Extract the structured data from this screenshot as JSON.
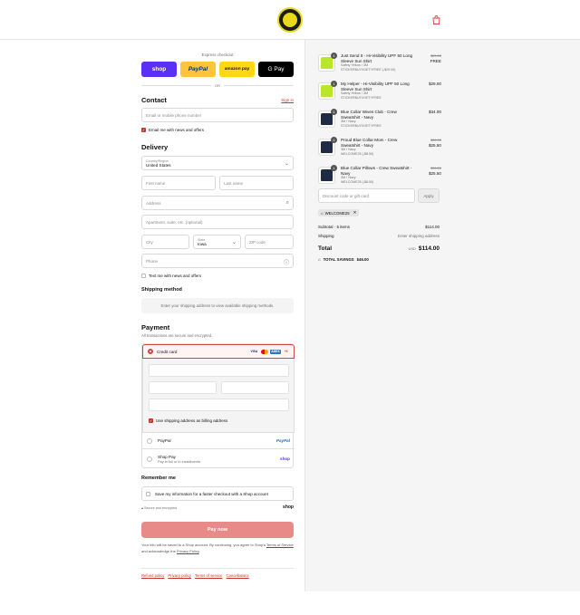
{
  "header": {
    "logo_icon": "store-logo-icon",
    "cart_icon": "shopping-bag-icon"
  },
  "express": {
    "label": "Express checkout",
    "buttons": [
      "shop",
      "PayPal",
      "amazon pay",
      "G Pay"
    ],
    "or": "OR"
  },
  "contact": {
    "title": "Contact",
    "sign_in": "Sign in",
    "email_placeholder": "Email or mobile phone number",
    "news_label": "Email me with news and offers"
  },
  "delivery": {
    "title": "Delivery",
    "country_label": "Country/Region",
    "country_value": "United States",
    "first_name": "First name",
    "last_name": "Last name",
    "address": "Address",
    "apartment": "Apartment, suite, etc. (optional)",
    "city": "City",
    "state_label": "State",
    "state_value": "Iowa",
    "zip": "ZIP code",
    "phone": "Phone",
    "text_label": "Text me with news and offers"
  },
  "shipping": {
    "title": "Shipping method",
    "note": "Enter your shipping address to view available shipping methods."
  },
  "payment": {
    "title": "Payment",
    "subtitle": "All transactions are secure and encrypted.",
    "credit_card": "Credit card",
    "card_brands": [
      "VISA",
      "",
      "AMEX",
      "+5"
    ],
    "billing_label": "Use shipping address as billing address",
    "paypal": "PayPal",
    "paypal_brand": "PayPal",
    "shop_pay": "Shop Pay",
    "shop_pay_sub": "Pay in full or in installments",
    "shop_brand": "shop"
  },
  "remember": {
    "title": "Remember me",
    "save_label": "Save my information for a faster checkout with a Shop account",
    "secure": "Secure and encrypted",
    "shop_brand": "shop"
  },
  "pay_now": "Pay now",
  "legal": {
    "line1": "Your info will be saved to a Shop account. By continuing, you agree to Shop's",
    "terms": "Terms of Service",
    "mid": "and acknowledge the",
    "privacy": "Privacy Policy",
    "end": "."
  },
  "footer_links": [
    "Refund policy",
    "Privacy policy",
    "Terms of service",
    "Cancellations"
  ],
  "order": {
    "items": [
      {
        "qty": "1",
        "name": "Just Send It - Hi-Visibility UPF 50 Long Sleeve Sun Shirt",
        "variant": "Safety Yellow / 3M",
        "discount": "STICKERBUYXGETYFREE (-$29.00)",
        "old_price": "$29.00",
        "price": "FREE",
        "color": "yel"
      },
      {
        "qty": "1",
        "name": "My Helper - Hi-Visibility UPF 50 Long Sleeve Sun Shirt",
        "variant": "Safety Yellow / 3M",
        "discount": "STICKERBUYXGETYFREE",
        "old_price": "",
        "price": "$29.00",
        "color": "yel"
      },
      {
        "qty": "1",
        "name": "Blue Collar Wives Club - Crew Sweatshirt - Navy",
        "variant": "3M / Navy",
        "discount": "STICKERBUYXGETYFREE",
        "old_price": "",
        "price": "$34.00",
        "color": "navy"
      },
      {
        "qty": "1",
        "name": "Proud Blue Collar Mom - Crew Sweatshirt - Navy",
        "variant": "3M / Navy",
        "discount": "WELCOME25 (-$8.50)",
        "old_price": "$34.00",
        "price": "$25.50",
        "color": "navy"
      },
      {
        "qty": "1",
        "name": "Blue Collar Pillows - Crew Sweatshirt - Navy",
        "variant": "3M / Navy",
        "discount": "WELCOME25 (-$8.50)",
        "old_price": "$34.00",
        "price": "$25.50",
        "color": "navy"
      }
    ],
    "discount_placeholder": "Discount code or gift card",
    "apply": "Apply",
    "applied_code": "WELCOME25",
    "subtotal_label": "Subtotal · 5 items",
    "subtotal_value": "$114.00",
    "shipping_label": "Shipping",
    "shipping_value": "Enter shipping address",
    "total_label": "Total",
    "currency": "USD",
    "total_value": "$114.00",
    "savings_label": "TOTAL SAVINGS",
    "savings_value": "$46.00"
  },
  "colors": {
    "accent": "#c0392b",
    "pay_now_bg": "#e88a87"
  }
}
